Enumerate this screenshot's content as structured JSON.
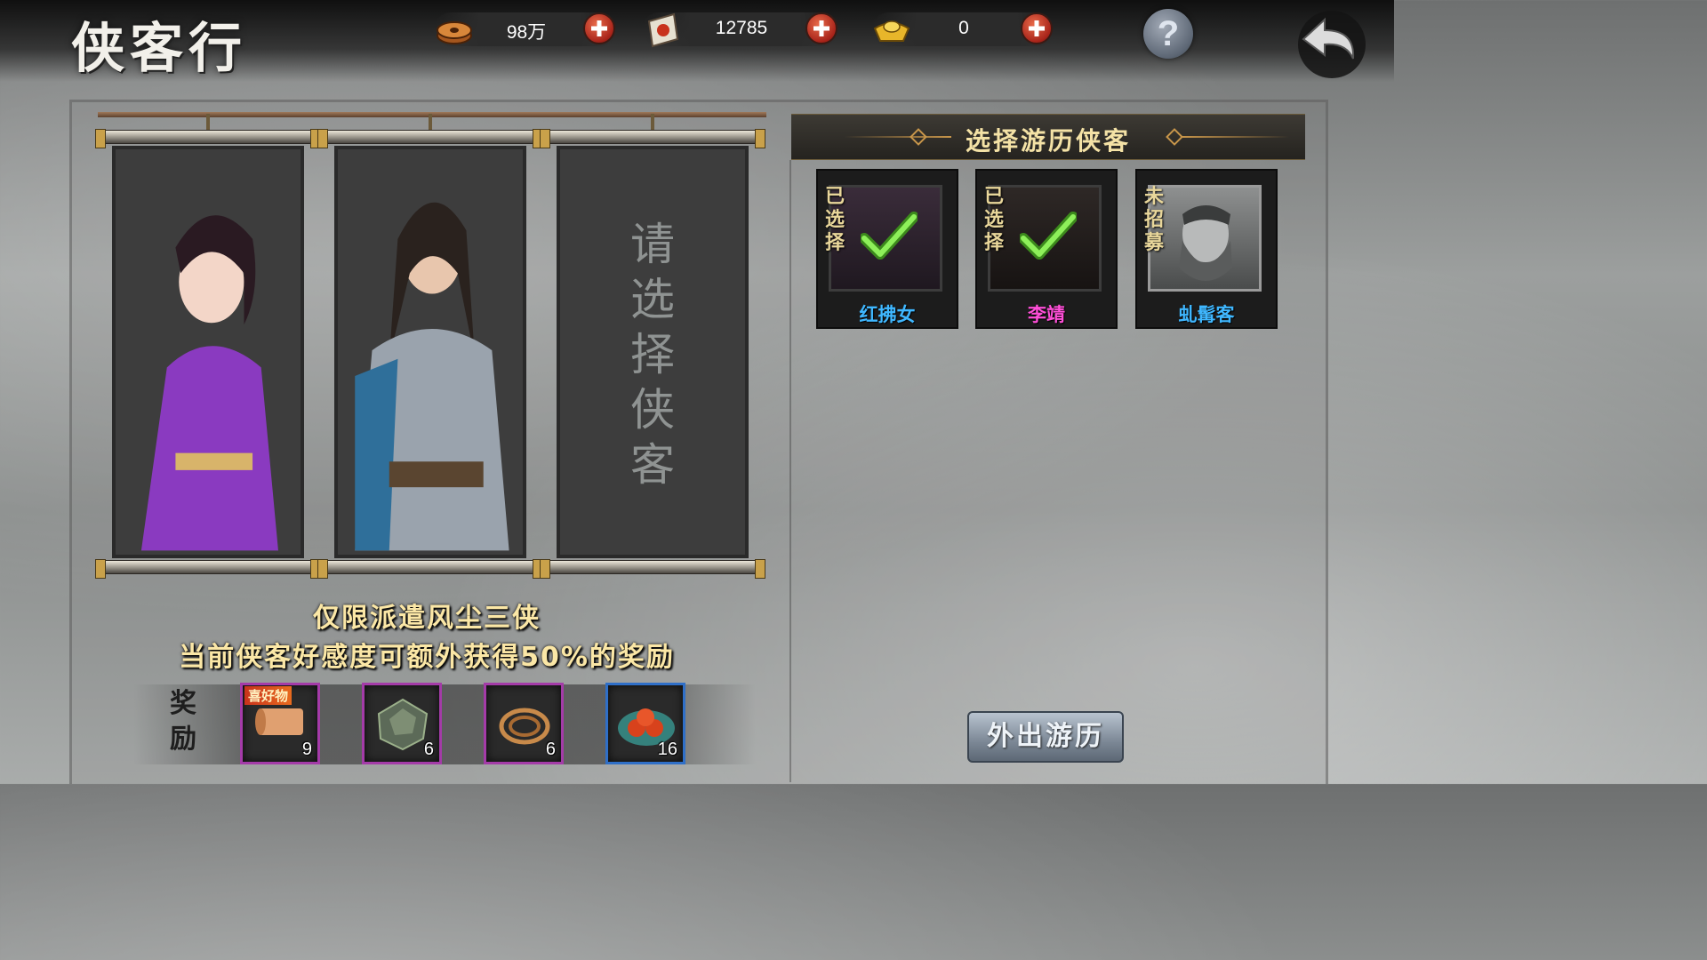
{
  "header": {
    "title": "侠客行",
    "currencies": [
      {
        "icon": "copper-coins-icon",
        "value": "98万"
      },
      {
        "icon": "scroll-token-icon",
        "value": "12785"
      },
      {
        "icon": "gold-ingot-icon",
        "value": "0"
      }
    ],
    "help_label": "?"
  },
  "scrolls": {
    "empty_slot_text": "请选择侠客"
  },
  "hint": {
    "line1": "仅限派遣风尘三侠",
    "line2": "当前侠客好感度可额外获得50%的奖励"
  },
  "rewards": {
    "label": "奖励",
    "items": [
      {
        "icon": "fabric-roll-icon",
        "count": "9",
        "tag": "喜好物",
        "rarity": "purple"
      },
      {
        "icon": "ore-crystal-icon",
        "count": "6",
        "rarity": "purple"
      },
      {
        "icon": "rope-coil-icon",
        "count": "6",
        "rarity": "purple"
      },
      {
        "icon": "red-fruits-icon",
        "count": "16",
        "rarity": "blue"
      }
    ]
  },
  "panel": {
    "title": "选择游历侠客",
    "heroes": [
      {
        "name": "红拂女",
        "status": "已选择",
        "selected": true,
        "name_color": "#3fb7ff"
      },
      {
        "name": "李靖",
        "status": "已选择",
        "selected": true,
        "name_color": "#ff4fd8"
      },
      {
        "name": "虬髯客",
        "status": "未招募",
        "selected": false,
        "name_color": "#3fb7ff"
      }
    ]
  },
  "actions": {
    "go_label": "外出游历"
  }
}
